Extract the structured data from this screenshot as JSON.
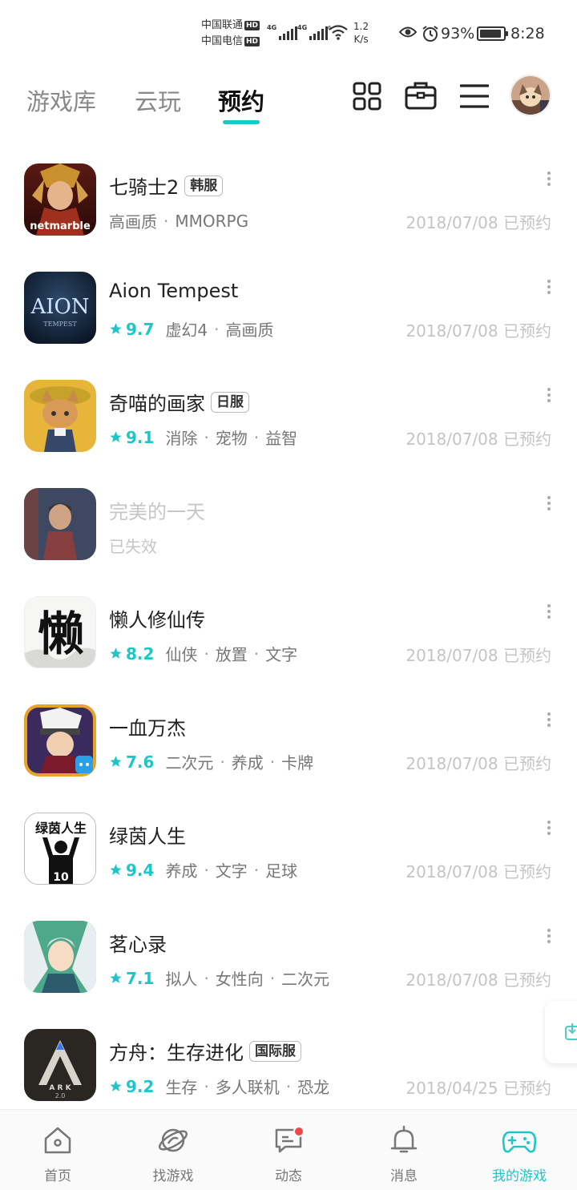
{
  "status_bar": {
    "carrier1": "中国联通",
    "carrier2": "中国电信",
    "hd": "HD",
    "net1": "4G",
    "net2": "4G",
    "wifi_label": "6",
    "speed_value": "1.2",
    "speed_unit": "K/s",
    "battery_pct": "93%",
    "battery_level": 0.93,
    "time": "8:28"
  },
  "header": {
    "tabs": [
      {
        "label": "游戏库"
      },
      {
        "label": "云玩"
      },
      {
        "label": "预约"
      }
    ],
    "active_tab": 2,
    "icons": [
      "grid-icon",
      "briefcase-icon",
      "menu-icon"
    ]
  },
  "games": [
    {
      "name": "七骑士2",
      "badge": "韩服",
      "rating": "",
      "tags": [
        "高画质",
        "MMORPG"
      ],
      "date": "2018/07/08 已预约",
      "status": ""
    },
    {
      "name": "Aion Tempest",
      "badge": "",
      "rating": "9.7",
      "tags": [
        "虚幻4",
        "高画质"
      ],
      "date": "2018/07/08 已预约",
      "status": ""
    },
    {
      "name": "奇喵的画家",
      "badge": "日服",
      "rating": "9.1",
      "tags": [
        "消除",
        "宠物",
        "益智"
      ],
      "date": "2018/07/08 已预约",
      "status": ""
    },
    {
      "name": "完美的一天",
      "badge": "",
      "rating": "",
      "tags": [],
      "date": "",
      "status": "已失效"
    },
    {
      "name": "懒人修仙传",
      "badge": "",
      "rating": "8.2",
      "tags": [
        "仙侠",
        "放置",
        "文字"
      ],
      "date": "2018/07/08 已预约",
      "status": ""
    },
    {
      "name": "一血万杰",
      "badge": "",
      "rating": "7.6",
      "tags": [
        "二次元",
        "养成",
        "卡牌"
      ],
      "date": "2018/07/08 已预约",
      "status": ""
    },
    {
      "name": "绿茵人生",
      "badge": "",
      "rating": "9.4",
      "tags": [
        "养成",
        "文字",
        "足球"
      ],
      "date": "2018/07/08 已预约",
      "status": ""
    },
    {
      "name": "茗心录",
      "badge": "",
      "rating": "7.1",
      "tags": [
        "拟人",
        "女性向",
        "二次元"
      ],
      "date": "2018/07/08 已预约",
      "status": ""
    },
    {
      "name": "方舟：生存进化",
      "badge": "国际服",
      "rating": "9.2",
      "tags": [
        "生存",
        "多人联机",
        "恐龙"
      ],
      "date": "2018/04/25 已预约",
      "status": ""
    }
  ],
  "game_icons": {
    "icon0_text": "netmarble",
    "icon1_text": "AION",
    "icon1_sub": "TEMPEST",
    "icon4_text": "懒",
    "icon6_text": "绿茵人生",
    "icon6_num": "10",
    "icon8_text": "A R K",
    "icon8_sub": "2.0"
  },
  "bottom_nav": [
    {
      "label": "首页",
      "icon": "home-icon"
    },
    {
      "label": "找游戏",
      "icon": "planet-icon"
    },
    {
      "label": "动态",
      "icon": "chat-icon"
    },
    {
      "label": "消息",
      "icon": "bell-icon"
    },
    {
      "label": "我的游戏",
      "icon": "gamepad-icon"
    }
  ],
  "colors": {
    "accent": "#1ec7c7",
    "text": "#222222",
    "muted": "#777777",
    "date": "#c4c4c4",
    "notify": "#f04848"
  }
}
